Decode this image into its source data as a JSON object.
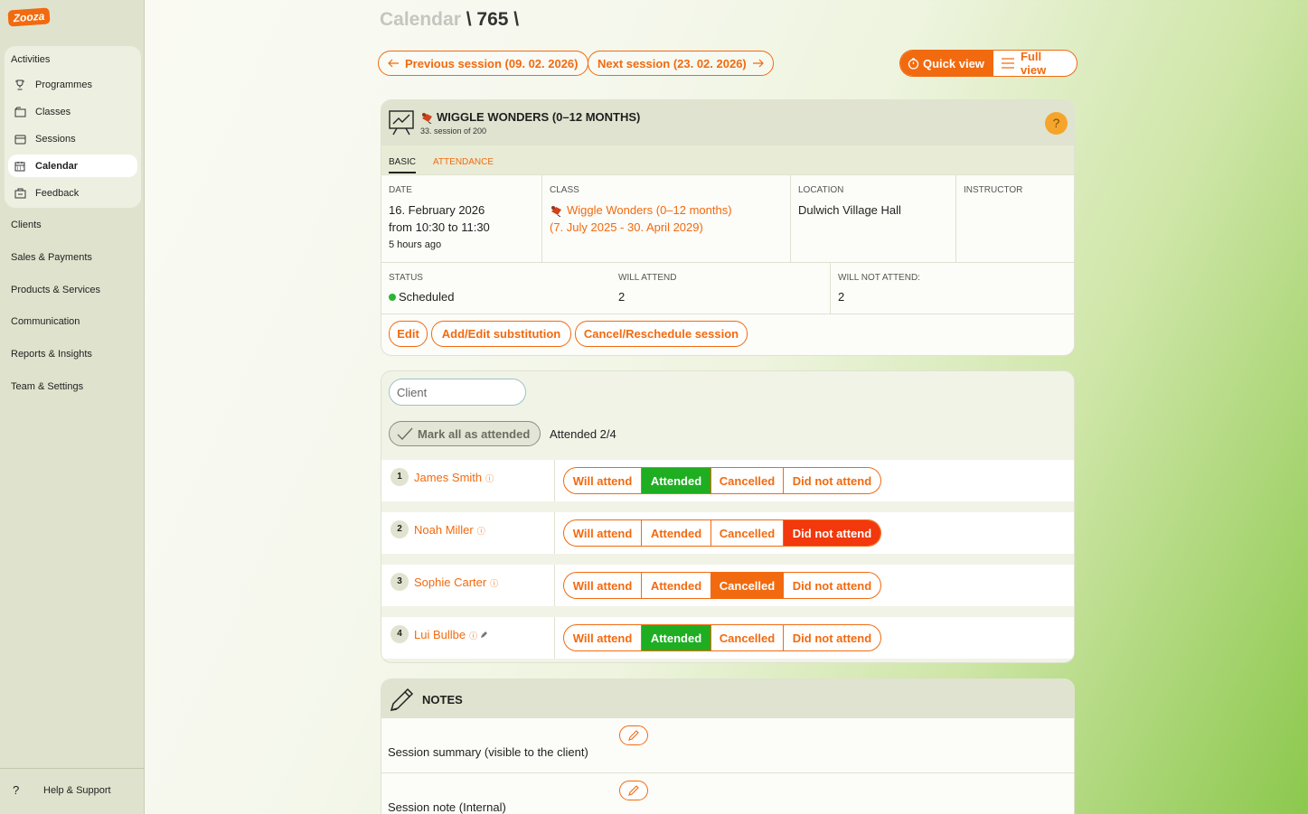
{
  "logo": "Zooza",
  "sidebar": {
    "activities_title": "Activities",
    "activities": [
      {
        "label": "Programmes",
        "icon": "trophy-icon"
      },
      {
        "label": "Classes",
        "icon": "folder-icon"
      },
      {
        "label": "Sessions",
        "icon": "sessions-icon"
      },
      {
        "label": "Calendar",
        "icon": "calendar-icon",
        "active": true
      },
      {
        "label": "Feedback",
        "icon": "feedback-icon"
      }
    ],
    "items": [
      "Clients",
      "Sales & Payments",
      "Products & Services",
      "Communication",
      "Reports & Insights",
      "Team & Settings"
    ],
    "help": "Help & Support"
  },
  "header": {
    "crumb1": "Calendar",
    "sep1": " \\ ",
    "crumb2": "765",
    "sep2": " \\",
    "prev_session": "Previous session (09. 02. 2026)",
    "next_session": "Next session (23. 02. 2026)",
    "quick_view": "Quick view",
    "full_view": "Full view"
  },
  "session": {
    "title": "WIGGLE WONDERS (0–12 MONTHS)",
    "subtitle": "33. session of 200",
    "help": "?",
    "tabs": {
      "basic": "BASIC",
      "attendance": "ATTENDANCE"
    },
    "date_label": "DATE",
    "date": "16. February 2026",
    "time": "from 10:30 to 11:30",
    "relative": "5 hours ago",
    "class_label": "CLASS",
    "class_name": "Wiggle Wonders (0–12 months)",
    "class_range": "(7. July 2025 - 30. April 2029)",
    "location_label": "LOCATION",
    "location": "Dulwich Village Hall",
    "instructor_label": "INSTRUCTOR",
    "status_label": "STATUS",
    "status": "Scheduled",
    "status_color": "#2bb534",
    "will_attend_label": "WILL ATTEND",
    "will_attend": "2",
    "will_not_attend_label": "WILL NOT ATTEND:",
    "will_not_attend": "2",
    "actions": {
      "edit": "Edit",
      "substitution": "Add/Edit substitution",
      "cancel": "Cancel/Reschedule session"
    }
  },
  "attendance": {
    "search_placeholder": "Client",
    "mark_all": "Mark all as attended",
    "count": "Attended 2/4",
    "options": [
      "Will attend",
      "Attended",
      "Cancelled",
      "Did not attend"
    ],
    "clients": [
      {
        "num": "1",
        "name": "James Smith",
        "state": "Attended"
      },
      {
        "num": "2",
        "name": "Noah Miller",
        "state": "Did not attend"
      },
      {
        "num": "3",
        "name": "Sophie Carter",
        "state": "Cancelled"
      },
      {
        "num": "4",
        "name": "Lui Bullbe",
        "state": "Attended"
      }
    ]
  },
  "notes": {
    "title": "NOTES",
    "summary_label": "Session summary (visible to the client)",
    "internal_label": "Session note (Internal)"
  },
  "colors": {
    "accent": "#f26a0f",
    "attended": "#1fae22",
    "did_not_attend": "#f2380c"
  }
}
